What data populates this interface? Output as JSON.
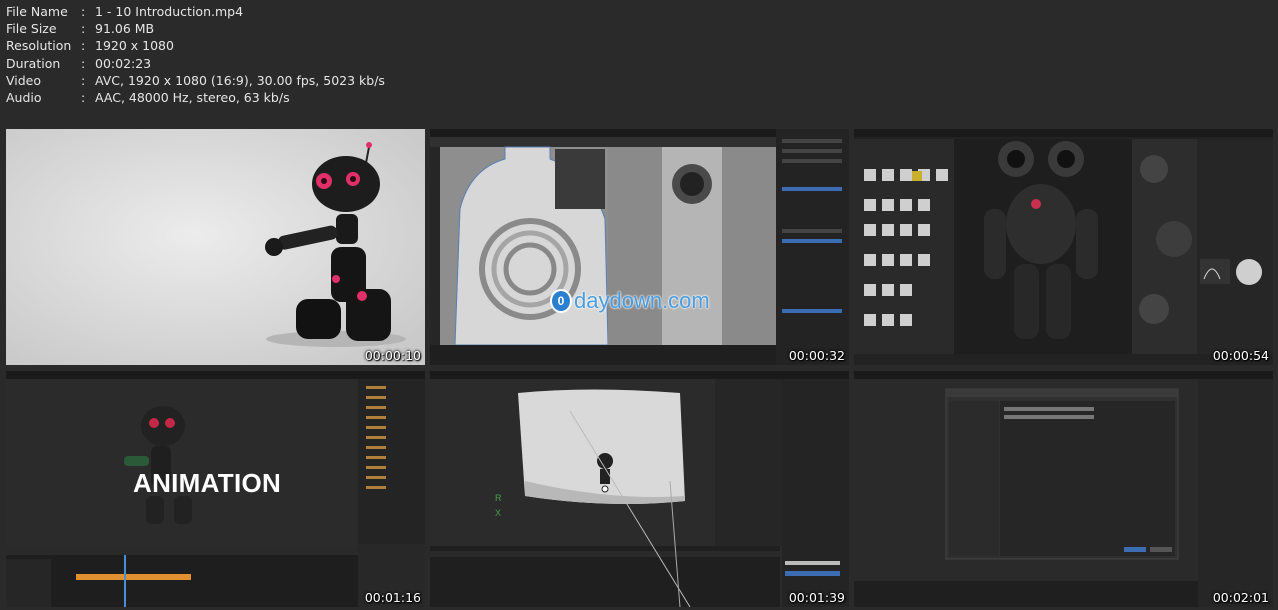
{
  "info": {
    "rows": [
      {
        "key": "File Name",
        "sep": ":",
        "value": "1 - 10 Introduction.mp4"
      },
      {
        "key": "File Size",
        "sep": ":",
        "value": "91.06 MB"
      },
      {
        "key": "Resolution",
        "sep": ":",
        "value": "1920 x 1080"
      },
      {
        "key": "Duration",
        "sep": ":",
        "value": "00:02:23"
      },
      {
        "key": "Video",
        "sep": ":",
        "value": "AVC, 1920 x 1080 (16:9), 30.00 fps, 5023 kb/s"
      },
      {
        "key": "Audio",
        "sep": ":",
        "value": "AAC, 48000 Hz, stereo, 63 kb/s"
      }
    ]
  },
  "thumbnails": [
    {
      "timestamp": "00:00:10"
    },
    {
      "timestamp": "00:00:32",
      "watermark": "daydown.com",
      "watermark_logo": "0"
    },
    {
      "timestamp": "00:00:54"
    },
    {
      "timestamp": "00:01:16",
      "overlay_text": "ANIMATION"
    },
    {
      "timestamp": "00:01:39"
    },
    {
      "timestamp": "00:02:01"
    }
  ]
}
